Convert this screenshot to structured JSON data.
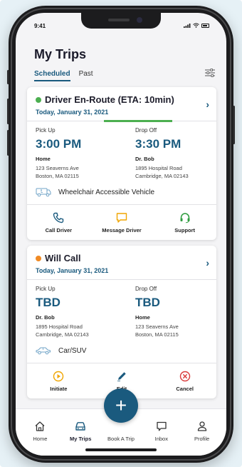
{
  "status_bar": {
    "time": "9:41"
  },
  "header": {
    "title": "My Trips"
  },
  "tabs": [
    {
      "label": "Scheduled",
      "active": true
    },
    {
      "label": "Past",
      "active": false
    }
  ],
  "trips": [
    {
      "status": "Driver En-Route (ETA: 10min)",
      "status_color": "#4caf50",
      "date": "Today, January 31, 2021",
      "pickup": {
        "label": "Pick Up",
        "time": "3:00 PM",
        "place": "Home",
        "addr1": "123 Seaverns Ave",
        "addr2": "Boston, MA 02115"
      },
      "dropoff": {
        "label": "Drop Off",
        "time": "3:30 PM",
        "place": "Dr. Bob",
        "addr1": "1895 Hospital Road",
        "addr2": "Cambridge, MA 02143"
      },
      "vehicle": "Wheelchair Accessible Vehicle",
      "actions": [
        {
          "label": "Call Driver",
          "icon": "phone-icon",
          "color": "#1a5a7e"
        },
        {
          "label": "Message Driver",
          "icon": "message-icon",
          "color": "#f0a500"
        },
        {
          "label": "Support",
          "icon": "headset-icon",
          "color": "#2e9c3f"
        }
      ]
    },
    {
      "status": "Will Call",
      "status_color": "#f08a24",
      "date": "Today, January 31, 2021",
      "pickup": {
        "label": "Pick Up",
        "time": "TBD",
        "place": "Dr. Bob",
        "addr1": "1895 Hospital  Road",
        "addr2": "Cambridge, MA 02143"
      },
      "dropoff": {
        "label": "Drop Off",
        "time": "TBD",
        "place": "Home",
        "addr1": "123 Seaverns Ave",
        "addr2": "Boston, MA 02115"
      },
      "vehicle": "Car/SUV",
      "actions": [
        {
          "label": "Initiate",
          "icon": "play-circle-icon",
          "color": "#f0a500"
        },
        {
          "label": "Edit",
          "icon": "pencil-icon",
          "color": "#1a5a7e"
        },
        {
          "label": "Cancel",
          "icon": "cancel-circle-icon",
          "color": "#d93a3a"
        }
      ]
    }
  ],
  "nav": [
    {
      "label": "Home",
      "icon": "home-icon",
      "active": false
    },
    {
      "label": "My Trips",
      "icon": "car-icon",
      "active": true
    },
    {
      "label": "Book A Trip",
      "icon": "plus-icon",
      "active": false
    },
    {
      "label": "Inbox",
      "icon": "inbox-icon",
      "active": false
    },
    {
      "label": "Profile",
      "icon": "profile-icon",
      "active": false
    }
  ],
  "fab_symbol": "+",
  "colors": {
    "primary": "#1a5a7e",
    "en_route": "#4caf50",
    "will_call": "#f08a24"
  }
}
